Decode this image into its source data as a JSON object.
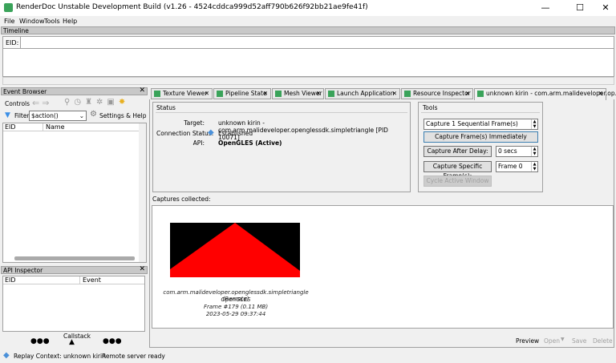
{
  "window": {
    "title": "RenderDoc Unstable Development Build (v1.26 - 4524cddca999d52aff790b626f92bb21ae9fe41f)",
    "minimize": "—",
    "maximize": "☐",
    "close": "✕"
  },
  "menu": [
    "File",
    "Window",
    "Tools",
    "Help"
  ],
  "timeline": {
    "title": "Timeline",
    "eid_label": "EID:"
  },
  "event_browser": {
    "title": "Event Browser",
    "controls_label": "Controls",
    "filter_label": "Filter",
    "filter_value": "$action()",
    "settings_label": "Settings & Help",
    "columns": [
      "EID",
      "Name"
    ]
  },
  "api_inspector": {
    "title": "API Inspector",
    "columns": [
      "EID",
      "Event"
    ],
    "callstack_label": "Callstack"
  },
  "tabs": [
    {
      "label": "Texture Viewer"
    },
    {
      "label": "Pipeline State"
    },
    {
      "label": "Mesh Viewer"
    },
    {
      "label": "Launch Application"
    },
    {
      "label": "Resource Inspector"
    },
    {
      "label": "unknown kirin - com.arm.malideveloper.op...",
      "active": true
    }
  ],
  "status": {
    "title": "Status",
    "target_label": "Target:",
    "target_value": "unknown kirin - com.arm.malideveloper.openglessdk.simpletriangle [PID 10071]",
    "connection_label": "Connection Status:",
    "connection_value": "Established",
    "api_label": "API:",
    "api_value": "OpenGLES (Active)"
  },
  "tools": {
    "title": "Tools",
    "sequential": "Capture 1 Sequential Frame(s)",
    "capture_now": "Capture Frame(s) Immediately",
    "capture_delay": "Capture After Delay:",
    "delay_value": "0 secs",
    "capture_specific": "Capture Specific Frame(s):",
    "frame_value": "Frame 0",
    "cycle": "Cycle Active Window"
  },
  "captures": {
    "label": "Captures collected:",
    "items": [
      {
        "name": "com.arm.malideveloper.openglessdk.simpletriangle (Remote)",
        "api": "OpenGLES",
        "frame": "Frame #179 (0.11 MB)",
        "date": "2023-05-29 09:37:44"
      }
    ],
    "actions": {
      "preview": "Preview",
      "open": "Open",
      "save": "Save",
      "delete": "Delete"
    }
  },
  "statusbar": {
    "replay": "Replay Context: unknown kirin",
    "server": "Remote server ready"
  },
  "colors": {
    "accent": "#3aa35a",
    "triangle": "#ff0000",
    "background": "#000000"
  }
}
